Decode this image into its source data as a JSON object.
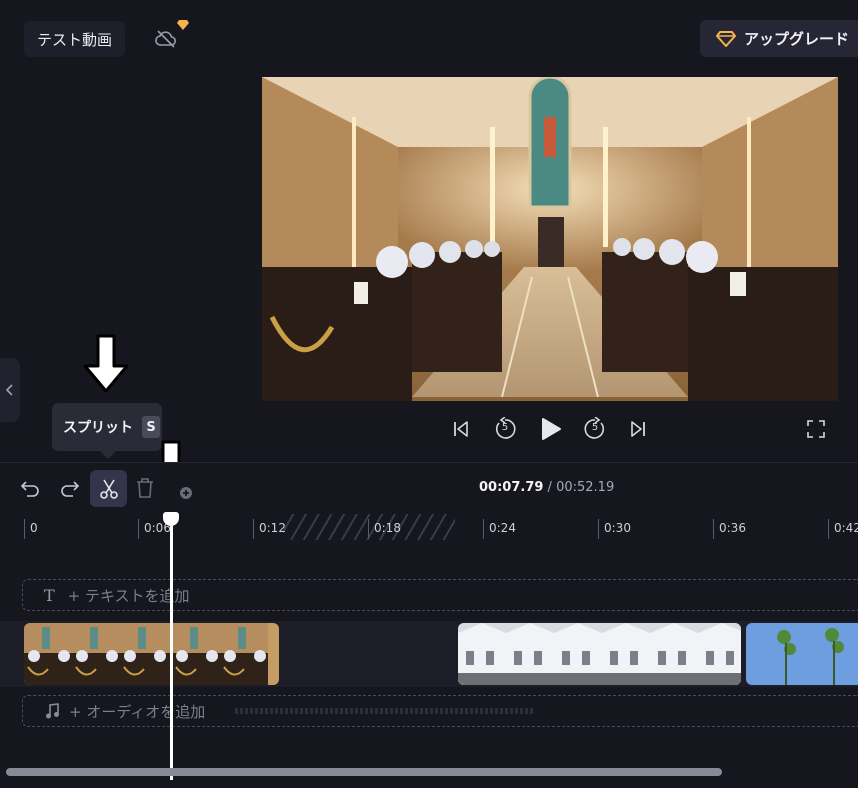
{
  "header": {
    "project_title": "テスト動画",
    "cloud_icon": "cloud-off-icon",
    "upgrade_label": "アップグレード",
    "premium_color": "#f6b54a"
  },
  "player": {
    "controls": [
      "skip-back-icon",
      "rewind-5-icon",
      "play-icon",
      "forward-5-icon",
      "skip-forward-icon",
      "fullscreen-icon"
    ],
    "rewind_seconds": "5",
    "forward_seconds": "5"
  },
  "tooltip": {
    "label": "スプリット",
    "shortcut": "S"
  },
  "timeline": {
    "current_time": "00:07.79",
    "separator": " / ",
    "total_time": "00:52.19",
    "ruler_labels": [
      "0",
      "0:06",
      "0:12",
      "0:18",
      "0:24",
      "0:30",
      "0:36",
      "0:42"
    ],
    "text_track_label": "+ テキストを追加",
    "text_track_icon": "T",
    "audio_track_label": "+ オーディオを追加"
  }
}
